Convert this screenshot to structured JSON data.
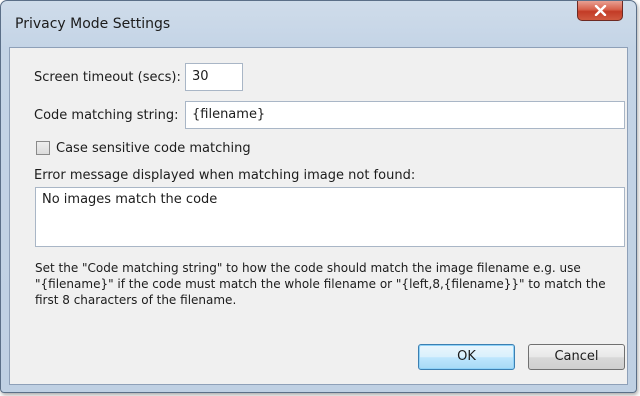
{
  "window": {
    "title": "Privacy Mode Settings"
  },
  "form": {
    "screen_timeout_label": "Screen timeout (secs):",
    "screen_timeout_value": "30",
    "code_matching_label": "Code matching string:",
    "code_matching_value": "{filename}",
    "case_sensitive_label": "Case sensitive code matching",
    "case_sensitive_checked": false,
    "error_message_label": "Error message displayed when matching image not found:",
    "error_message_value": "No images match the code",
    "help_line1": "Set the \"Code matching string\" to how the code should match the image filename e.g. use",
    "help_line2": "\"{filename}\" if the code must match the whole filename or \"{left,8,{filename}}\" to match the",
    "help_line3": "first 8 characters of the filename."
  },
  "buttons": {
    "ok_label": "OK",
    "cancel_label": "Cancel"
  },
  "icons": {
    "close": "close-icon",
    "checkbox": "checkbox-icon"
  },
  "colors": {
    "frame": "#c4d4e6",
    "close_button": "#c94a33",
    "default_button_border": "#3c7fb1"
  }
}
